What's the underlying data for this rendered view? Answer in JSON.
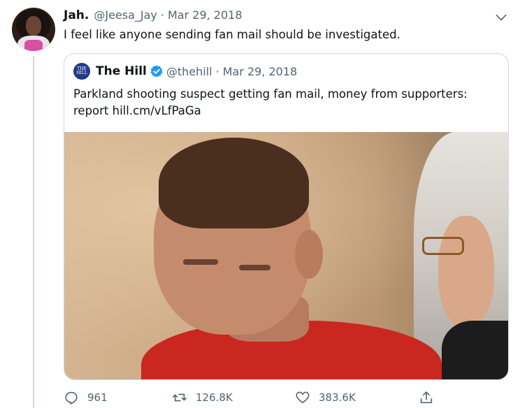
{
  "tweet": {
    "author_name": "Jah.",
    "author_handle": "@Jeesa_Jay",
    "separator": "·",
    "date": "Mar 29, 2018",
    "text": "I feel like anyone sending fan mail should be investigated.",
    "avatar_icon": "user-avatar",
    "more_icon": "chevron-down-icon"
  },
  "quoted_tweet": {
    "author_name": "The Hill",
    "author_handle": "@thehill",
    "separator": "·",
    "date": "Mar 29, 2018",
    "verified_icon": "verified-badge-icon",
    "logo_text": "THE HILL",
    "text": "Parkland shooting suspect getting fan mail, money from supporters: report hill.cm/vLfPaGa",
    "image_description_icon": "news-photo"
  },
  "actions": {
    "reply_count": "961",
    "retweet_count": "126.8K",
    "like_count": "383.6K",
    "reply_icon": "reply-icon",
    "retweet_icon": "retweet-icon",
    "like_icon": "heart-icon",
    "share_icon": "share-icon"
  },
  "colors": {
    "secondary_text": "#536471",
    "border": "#cfd9de",
    "verified_blue": "#1d9bf0"
  }
}
